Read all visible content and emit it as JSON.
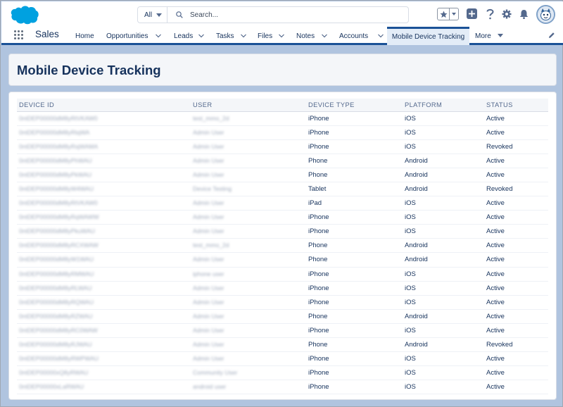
{
  "header": {
    "search": {
      "scope": "All",
      "placeholder": "Search..."
    }
  },
  "nav": {
    "app_name": "Sales",
    "items": [
      {
        "label": "Home",
        "has_menu": false
      },
      {
        "label": "Opportunities",
        "has_menu": true
      },
      {
        "label": "Leads",
        "has_menu": true
      },
      {
        "label": "Tasks",
        "has_menu": true
      },
      {
        "label": "Files",
        "has_menu": true
      },
      {
        "label": "Notes",
        "has_menu": true
      },
      {
        "label": "Accounts",
        "has_menu": true
      },
      {
        "label": "Mobile Device Tracking",
        "has_menu": false,
        "active": true
      },
      {
        "label": "More",
        "has_menu": true
      }
    ]
  },
  "page": {
    "title": "Mobile Device Tracking"
  },
  "table": {
    "columns": [
      "DEVICE ID",
      "USER",
      "DEVICE TYPE",
      "PLATFORM",
      "STATUS"
    ],
    "rows": [
      {
        "device_id": "0ntDEP00000dM8yRtVKAW0",
        "user": "test_mmo_2d",
        "device_type": "iPhone",
        "platform": "iOS",
        "status": "Active"
      },
      {
        "device_id": "0ntDEP00000dM8yRtqWA",
        "user": "Admin User",
        "device_type": "iPhone",
        "platform": "iOS",
        "status": "Active"
      },
      {
        "device_id": "0ntDEP00000dM8yRsjWAMA",
        "user": "Admin User",
        "device_type": "iPhone",
        "platform": "iOS",
        "status": "Revoked"
      },
      {
        "device_id": "0ntDEP00000dM8yPhWAU",
        "user": "Admin User",
        "device_type": "Phone",
        "platform": "Android",
        "status": "Active"
      },
      {
        "device_id": "0ntDEP00000dM8yPkWAU",
        "user": "Admin User",
        "device_type": "Phone",
        "platform": "Android",
        "status": "Active"
      },
      {
        "device_id": "0ntDEP00000dM8yW4WAU",
        "user": "Device Testing",
        "device_type": "Tablet",
        "platform": "Android",
        "status": "Revoked"
      },
      {
        "device_id": "0ntDEP00000dM8yRtVKAW0",
        "user": "Admin User",
        "device_type": "iPad",
        "platform": "iOS",
        "status": "Active"
      },
      {
        "device_id": "0ntDEP00000dM8yRqWAWW",
        "user": "Admin User",
        "device_type": "iPhone",
        "platform": "iOS",
        "status": "Active"
      },
      {
        "device_id": "0ntDEP00000dM8yPkuWAU",
        "user": "Admin User",
        "device_type": "iPhone",
        "platform": "iOS",
        "status": "Active"
      },
      {
        "device_id": "0ntDEP00000dM8yRCXWAW",
        "user": "test_mmo_2d",
        "device_type": "Phone",
        "platform": "Android",
        "status": "Active"
      },
      {
        "device_id": "0ntDEP00000dM8yW1WAU",
        "user": "Admin User",
        "device_type": "Phone",
        "platform": "Android",
        "status": "Active"
      },
      {
        "device_id": "0ntDEP00000dM8yRMWAU",
        "user": "iphone user",
        "device_type": "iPhone",
        "platform": "iOS",
        "status": "Active"
      },
      {
        "device_id": "0ntDEP00000dM8yRLWAU",
        "user": "Admin User",
        "device_type": "iPhone",
        "platform": "iOS",
        "status": "Active"
      },
      {
        "device_id": "0ntDEP00000dM8yRQWAU",
        "user": "Admin User",
        "device_type": "iPhone",
        "platform": "iOS",
        "status": "Active"
      },
      {
        "device_id": "0ntDEP00000dM8yRZWAU",
        "user": "Admin User",
        "device_type": "Phone",
        "platform": "Android",
        "status": "Active"
      },
      {
        "device_id": "0ntDEP00000dM8yRC0WAW",
        "user": "Admin User",
        "device_type": "iPhone",
        "platform": "iOS",
        "status": "Active"
      },
      {
        "device_id": "0ntDEP00000dM8yRJWAU",
        "user": "Admin User",
        "device_type": "Phone",
        "platform": "Android",
        "status": "Revoked"
      },
      {
        "device_id": "0ntDEP00000dM8yRWPWAU",
        "user": "Admin User",
        "device_type": "iPhone",
        "platform": "iOS",
        "status": "Active"
      },
      {
        "device_id": "0ntDEP00000xQ8yRWAU",
        "user": "Community User",
        "device_type": "iPhone",
        "platform": "iOS",
        "status": "Active"
      },
      {
        "device_id": "0ntDEP00000xLaRWAU",
        "user": "android user",
        "device_type": "iPhone",
        "platform": "iOS",
        "status": "Active"
      }
    ]
  },
  "colors": {
    "brand_blue": "#1b5297",
    "text": "#16325c",
    "page_bg": "#b0c4df",
    "logo_blue": "#00a1e0"
  },
  "icons": {
    "logo": "salesforce-cloud-logo",
    "search": "search-icon",
    "favorites": "star-icon",
    "new": "plus-icon",
    "help": "question-icon",
    "setup": "gear-icon",
    "notifications": "bell-icon",
    "user": "avatar",
    "apps": "app-launcher-icon",
    "edit_nav": "pencil-icon"
  }
}
